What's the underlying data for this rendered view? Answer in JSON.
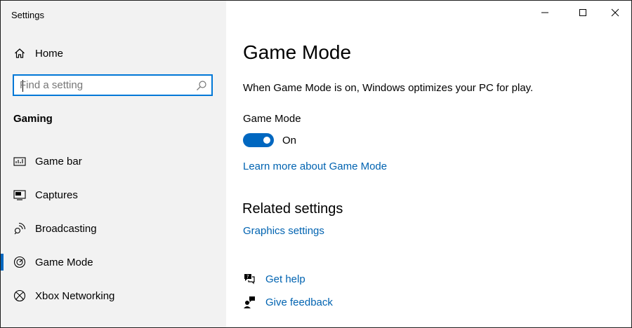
{
  "window": {
    "title": "Settings",
    "controls": {
      "minimize": "minimize",
      "maximize": "maximize",
      "close": "close"
    }
  },
  "sidebar": {
    "home_label": "Home",
    "search_placeholder": "Find a setting",
    "search_value": "",
    "section_header": "Gaming",
    "items": [
      {
        "label": "Game bar",
        "icon": "game-bar-icon",
        "selected": false
      },
      {
        "label": "Captures",
        "icon": "captures-icon",
        "selected": false
      },
      {
        "label": "Broadcasting",
        "icon": "broadcasting-icon",
        "selected": false
      },
      {
        "label": "Game Mode",
        "icon": "game-mode-icon",
        "selected": true
      },
      {
        "label": "Xbox Networking",
        "icon": "xbox-icon",
        "selected": false
      }
    ]
  },
  "main": {
    "title": "Game Mode",
    "description": "When Game Mode is on, Windows optimizes your PC for play.",
    "setting_label": "Game Mode",
    "toggle_state": "On",
    "toggle_on": true,
    "learn_more_link": "Learn more about Game Mode",
    "related_title": "Related settings",
    "related_link": "Graphics settings",
    "get_help": "Get help",
    "give_feedback": "Give feedback"
  },
  "colors": {
    "accent": "#0067c0",
    "link": "#0063b1",
    "sidebar_bg": "#f2f2f2",
    "search_border": "#0078d7"
  }
}
